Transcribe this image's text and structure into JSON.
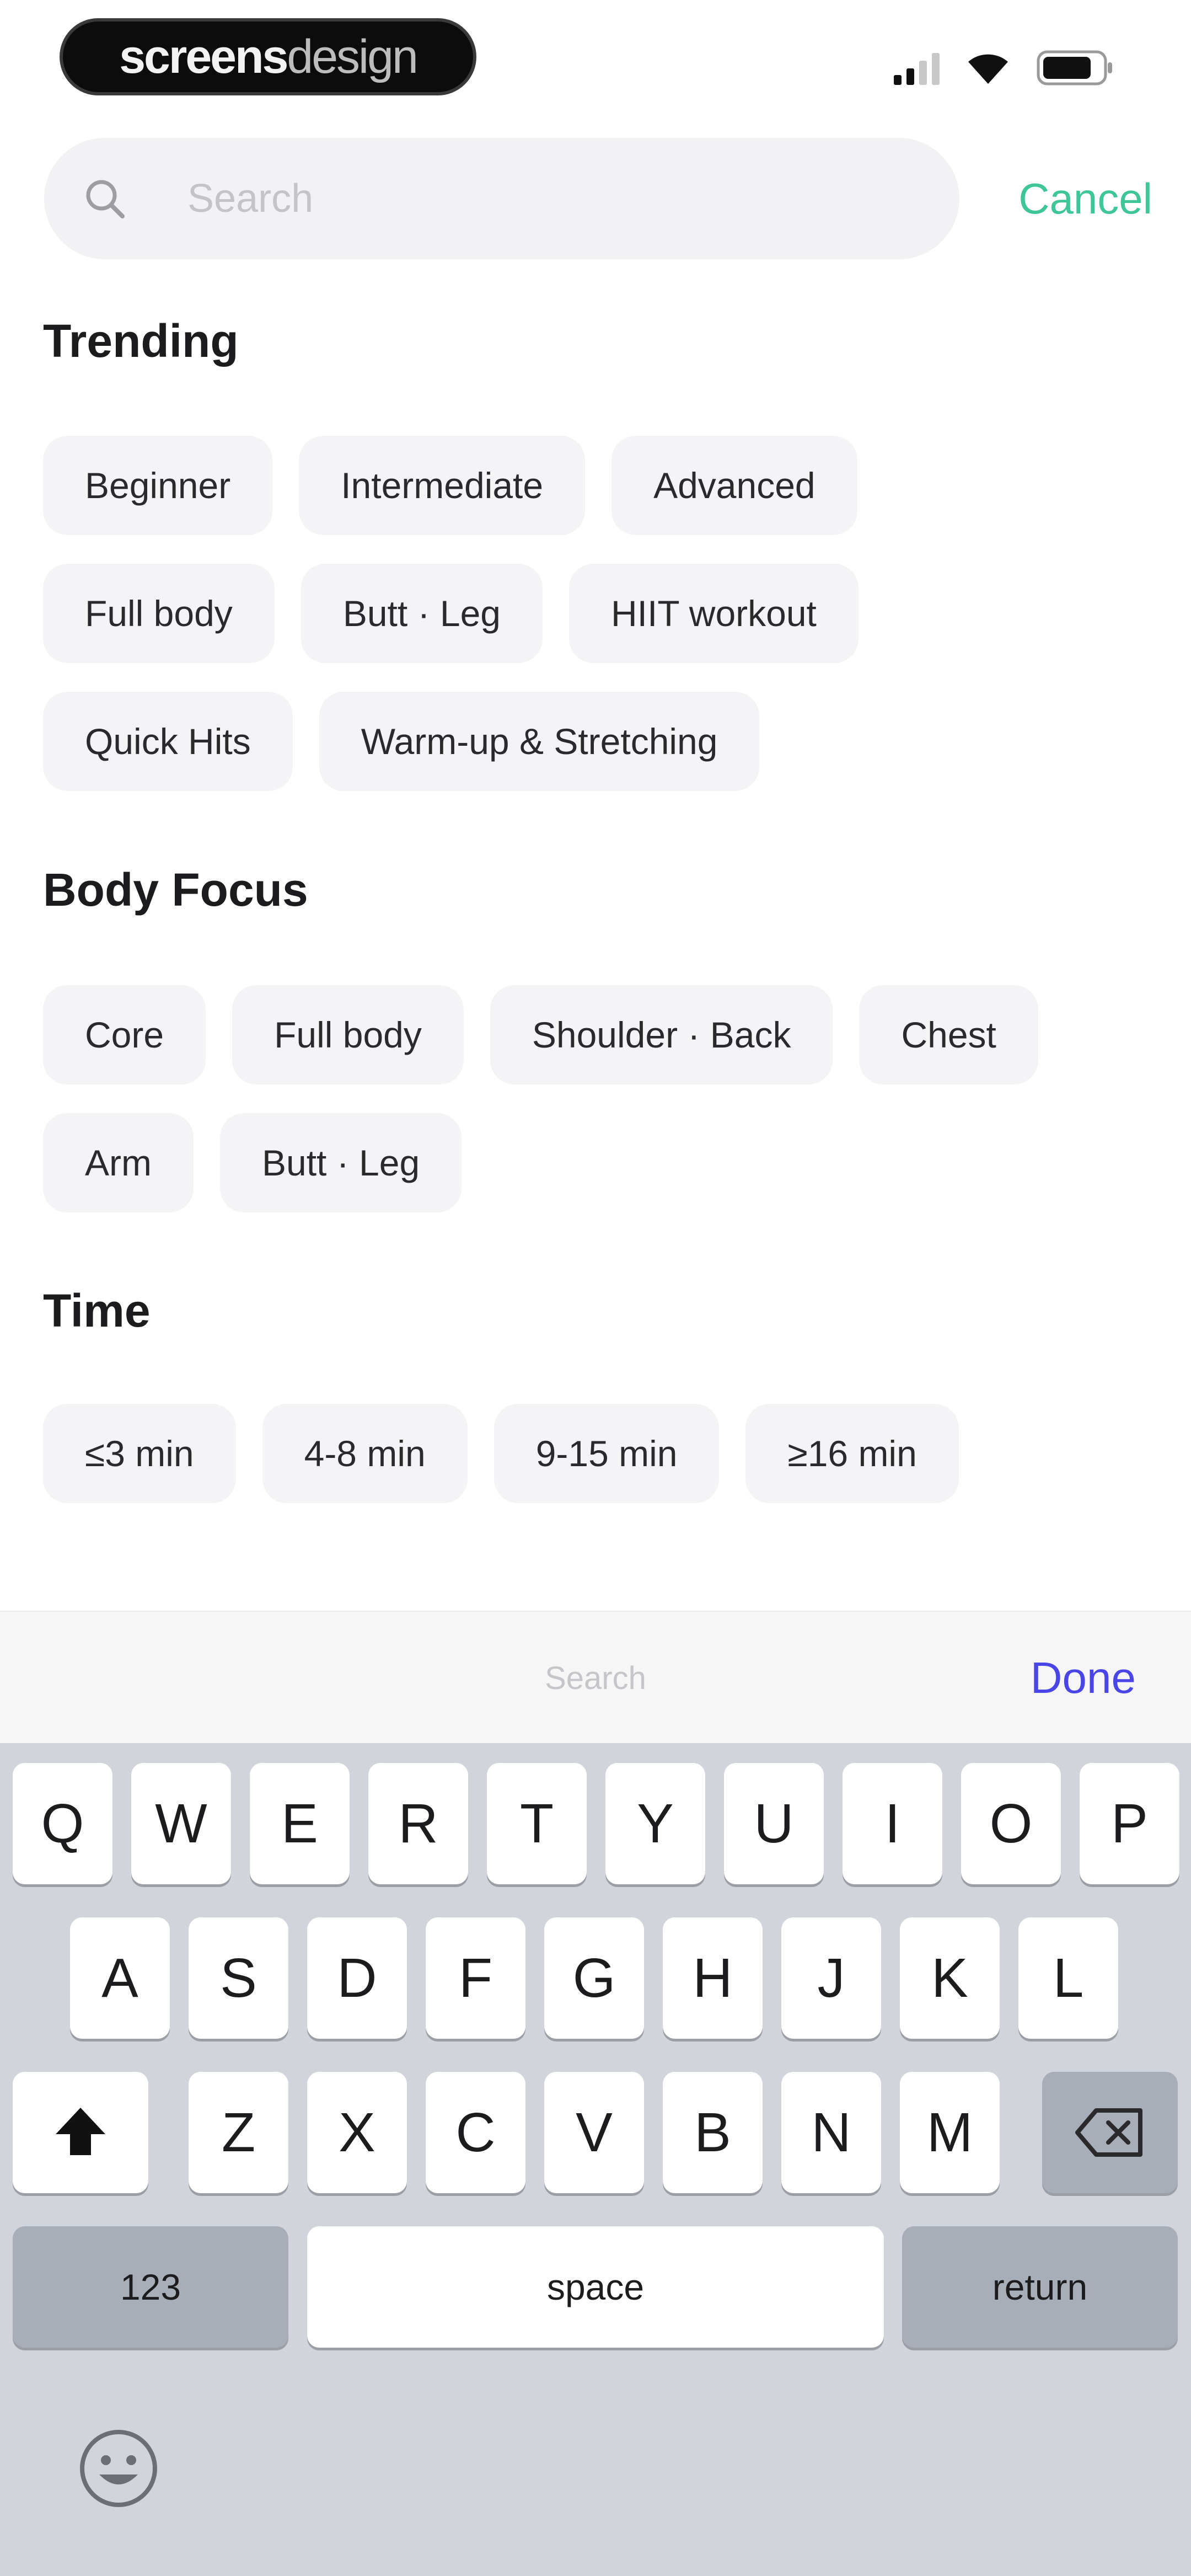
{
  "status_bar": {
    "brand_part1": "screens",
    "brand_part2": "design",
    "icons": [
      "signal-icon",
      "wifi-icon",
      "battery-icon"
    ]
  },
  "search": {
    "placeholder": "Search",
    "value": "",
    "cancel_label": "Cancel"
  },
  "sections": [
    {
      "title": "Trending",
      "rows": [
        [
          "Beginner",
          "Intermediate",
          "Advanced"
        ],
        [
          "Full body",
          "Butt · Leg",
          "HIIT workout"
        ],
        [
          "Quick Hits",
          "Warm-up & Stretching"
        ]
      ]
    },
    {
      "title": "Body Focus",
      "rows": [
        [
          "Core",
          "Full body",
          "Shoulder · Back",
          "Chest"
        ],
        [
          "Arm",
          "Butt · Leg"
        ]
      ]
    },
    {
      "title": "Time",
      "rows": [
        [
          "≤3 min",
          "4-8 min",
          "9-15 min",
          "≥16 min"
        ]
      ]
    }
  ],
  "keyboard_toolbar": {
    "placeholder": "Search",
    "done_label": "Done"
  },
  "keyboard": {
    "row1": [
      "Q",
      "W",
      "E",
      "R",
      "T",
      "Y",
      "U",
      "I",
      "O",
      "P"
    ],
    "row2": [
      "A",
      "S",
      "D",
      "F",
      "G",
      "H",
      "J",
      "K",
      "L"
    ],
    "row3": [
      "Z",
      "X",
      "C",
      "V",
      "B",
      "N",
      "M"
    ],
    "numbers_label": "123",
    "space_label": "space",
    "return_label": "return"
  },
  "colors": {
    "accent_cancel": "#3fc59a",
    "accent_done": "#4a45e6",
    "chip_bg": "#f4f4f6",
    "keyboard_bg": "#d1d4da"
  }
}
